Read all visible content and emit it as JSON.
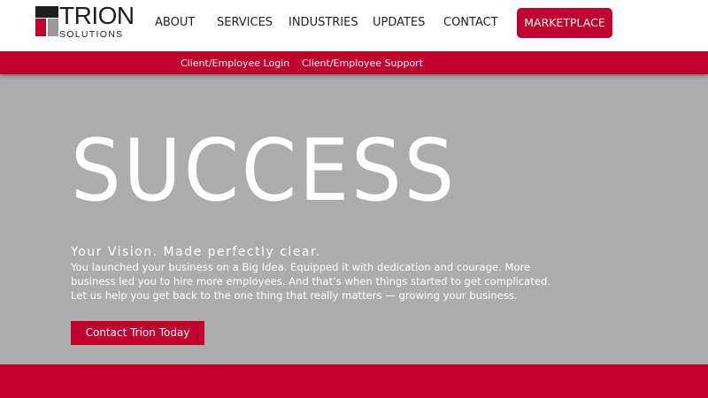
{
  "brand": {
    "name": "TRION",
    "sub": "SOLUTIONS",
    "colors": {
      "red": "#c2002f",
      "dark": "#1e1e1e",
      "gray": "#9a9a9a",
      "hero_bg": "#acacac"
    }
  },
  "nav": {
    "items": [
      {
        "label": "ABOUT"
      },
      {
        "label": "SERVICES"
      },
      {
        "label": "INDUSTRIES"
      },
      {
        "label": "UPDATES"
      },
      {
        "label": "CONTACT"
      }
    ],
    "marketplace_label": "MARKETPLACE"
  },
  "subnav": {
    "login_label": "Client/Employee Login",
    "support_label": "Client/Employee Support"
  },
  "hero": {
    "title": "SUCCESS",
    "subtitle": "Your Vision. Made perfectly clear.",
    "body": "You launched your business on a Big Idea. Equipped it with dedication and courage. More business led you to hire more employees. And that’s when things started to get complicated. Let us help you get back to the one thing that really matters — growing your business.",
    "cta_label": "Contact Trion Today"
  }
}
